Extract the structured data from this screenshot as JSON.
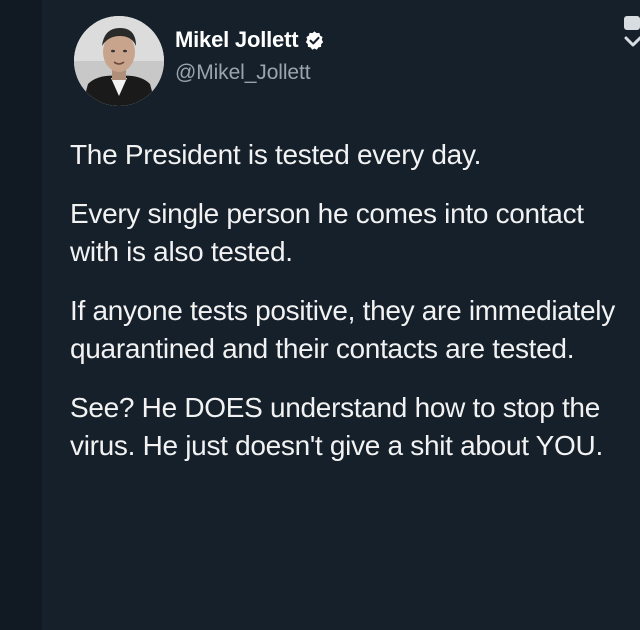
{
  "author": {
    "display_name": "Mikel Jollett",
    "handle": "@Mikel_Jollett"
  },
  "icons": {
    "avatar": "profile-photo",
    "verified": "verified-badge-icon",
    "menu": "chevron-down-icon"
  },
  "tweet": {
    "paragraphs": [
      "The President is tested every day.",
      "Every single person he comes into contact with is also tested.",
      "If anyone tests positive, they are immediately quarantined and their contacts are tested.",
      "See? He DOES understand how to stop the virus. He just doesn't give a shit about YOU."
    ]
  },
  "colors": {
    "background": "#15202b",
    "text": "#f2f2f2",
    "secondary_text": "#9aa4ad"
  }
}
